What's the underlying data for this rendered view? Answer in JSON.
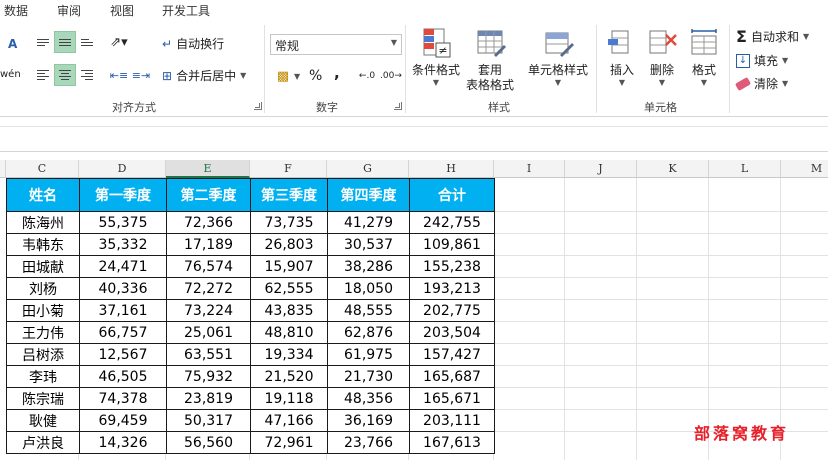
{
  "menu_tabs": [
    "数据",
    "审阅",
    "视图",
    "开发工具"
  ],
  "ribbon": {
    "alignment": {
      "wrap_text": "自动换行",
      "merge_center": "合并后居中",
      "group_label": "对齐方式"
    },
    "number": {
      "format_value": "常规",
      "percent": "%",
      "comma": ",",
      "group_label": "数字"
    },
    "styles": {
      "conditional": "条件格式",
      "table_format_line1": "套用",
      "table_format_line2": "表格格式",
      "cell_styles": "单元格样式",
      "group_label": "样式"
    },
    "cells": {
      "insert": "插入",
      "delete": "删除",
      "format": "格式",
      "group_label": "单元格"
    },
    "editing": {
      "autosum": "自动求和",
      "fill": "填充",
      "clear": "清除"
    },
    "left_cut_label": "A",
    "left_cut_label2": "wén"
  },
  "columns": [
    "C",
    "D",
    "E",
    "F",
    "G",
    "H",
    "I",
    "J",
    "K",
    "L",
    "M"
  ],
  "selected_column": "E",
  "table": {
    "headers": [
      "姓名",
      "第一季度",
      "第二季度",
      "第三季度",
      "第四季度",
      "合计"
    ],
    "rows": [
      [
        "陈海州",
        "55,375",
        "72,366",
        "73,735",
        "41,279",
        "242,755"
      ],
      [
        "韦韩东",
        "35,332",
        "17,189",
        "26,803",
        "30,537",
        "109,861"
      ],
      [
        "田城献",
        "24,471",
        "76,574",
        "15,907",
        "38,286",
        "155,238"
      ],
      [
        "刘杨",
        "40,336",
        "72,272",
        "62,555",
        "18,050",
        "193,213"
      ],
      [
        "田小菊",
        "37,161",
        "73,224",
        "43,835",
        "48,555",
        "202,775"
      ],
      [
        "王力伟",
        "66,757",
        "25,061",
        "48,810",
        "62,876",
        "203,504"
      ],
      [
        "吕树添",
        "12,567",
        "63,551",
        "19,334",
        "61,975",
        "157,427"
      ],
      [
        "李玮",
        "46,505",
        "75,932",
        "21,520",
        "21,730",
        "165,687"
      ],
      [
        "陈宗瑞",
        "74,378",
        "23,819",
        "19,118",
        "48,356",
        "165,671"
      ],
      [
        "耿健",
        "69,459",
        "50,317",
        "47,166",
        "36,169",
        "203,111"
      ],
      [
        "卢洪良",
        "14,326",
        "56,560",
        "72,961",
        "23,766",
        "167,613"
      ]
    ]
  },
  "watermark": "部落窝教育",
  "colors": {
    "header_fill": "#00b0f0",
    "accent_green": "#217346",
    "watermark_red": "#e8202a"
  }
}
